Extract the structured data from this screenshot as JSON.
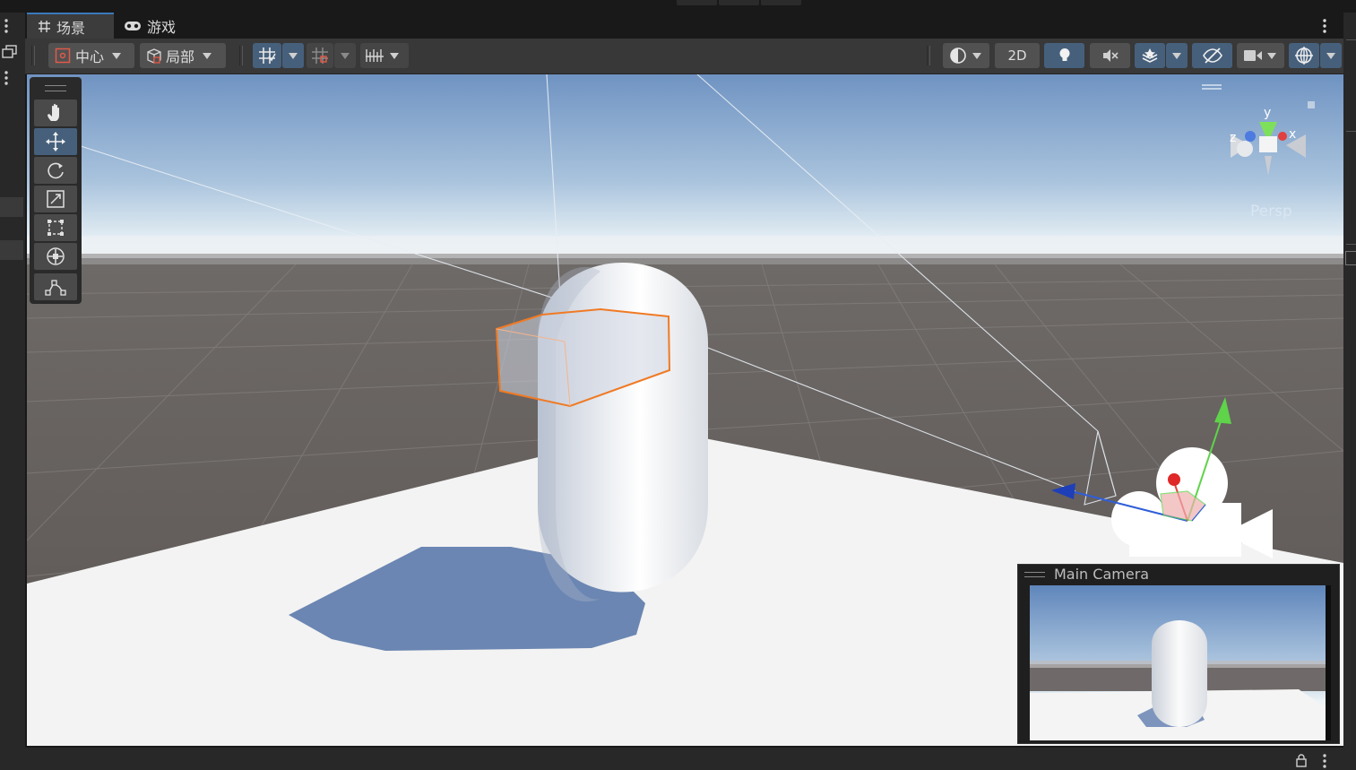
{
  "tabs": [
    {
      "label": "场景",
      "icon": "grid-hash-icon",
      "active": true
    },
    {
      "label": "游戏",
      "icon": "gamepad-icon",
      "active": false
    }
  ],
  "toolbar": {
    "pivot_label": "中心",
    "space_label": "局部",
    "mode_2d_label": "2D"
  },
  "viewport": {
    "projection_label": "Persp",
    "gizmo_axes": {
      "x": "x",
      "y": "y",
      "z": "z"
    }
  },
  "camera_preview": {
    "title": "Main Camera"
  },
  "colors": {
    "accent_blue": "#46607c",
    "tab_active_border": "#3a79bb",
    "selection_orange": "#f07a24"
  }
}
